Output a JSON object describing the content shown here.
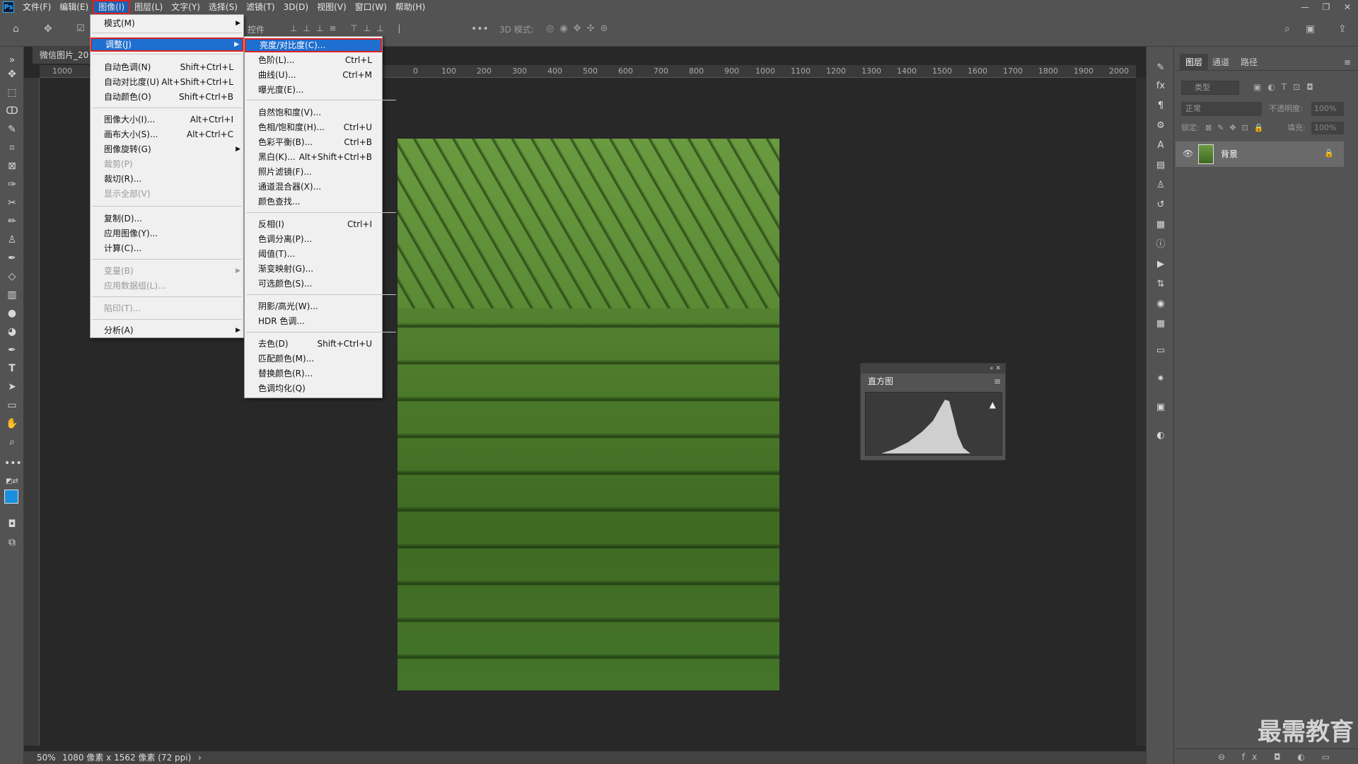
{
  "menubar": {
    "logo": "Ps",
    "items": [
      "文件(F)",
      "编辑(E)",
      "图像(I)",
      "图层(L)",
      "文字(Y)",
      "选择(S)",
      "滤镜(T)",
      "3D(D)",
      "视图(V)",
      "窗口(W)",
      "帮助(H)"
    ],
    "active_index": 2
  },
  "window_controls": [
    "—",
    "❐",
    "✕"
  ],
  "options_bar": {
    "partial_label": "控件",
    "mode_label": "3D 模式:",
    "more": "•••"
  },
  "document": {
    "tab_title": "微信图片_20",
    "ruler_ticks": [
      "1000",
      "90",
      "0",
      "100",
      "200",
      "300",
      "400",
      "500",
      "600",
      "700",
      "800",
      "900",
      "1000",
      "1100",
      "1200",
      "1300",
      "1400",
      "1500",
      "1600",
      "1700",
      "1800",
      "1900",
      "2000"
    ],
    "zoom": "50%",
    "doc_info": "1080 像素 x 1562 像素 (72 ppi)"
  },
  "image_menu": {
    "items": [
      {
        "label": "模式(M)",
        "shortcut": "",
        "submenu": true,
        "disabled": false
      },
      {
        "label": "调整(J)",
        "shortcut": "",
        "submenu": true,
        "disabled": false,
        "highlight": true
      },
      {
        "label": "自动色调(N)",
        "shortcut": "Shift+Ctrl+L",
        "disabled": false
      },
      {
        "label": "自动对比度(U)",
        "shortcut": "Alt+Shift+Ctrl+L",
        "disabled": false
      },
      {
        "label": "自动颜色(O)",
        "shortcut": "Shift+Ctrl+B",
        "disabled": false
      },
      {
        "label": "图像大小(I)...",
        "shortcut": "Alt+Ctrl+I",
        "disabled": false
      },
      {
        "label": "画布大小(S)...",
        "shortcut": "Alt+Ctrl+C",
        "disabled": false
      },
      {
        "label": "图像旋转(G)",
        "shortcut": "",
        "submenu": true,
        "disabled": false
      },
      {
        "label": "裁剪(P)",
        "shortcut": "",
        "disabled": true
      },
      {
        "label": "裁切(R)...",
        "shortcut": "",
        "disabled": false
      },
      {
        "label": "显示全部(V)",
        "shortcut": "",
        "disabled": true
      },
      {
        "label": "复制(D)...",
        "shortcut": "",
        "disabled": false
      },
      {
        "label": "应用图像(Y)...",
        "shortcut": "",
        "disabled": false
      },
      {
        "label": "计算(C)...",
        "shortcut": "",
        "disabled": false
      },
      {
        "label": "变量(B)",
        "shortcut": "",
        "submenu": true,
        "disabled": true
      },
      {
        "label": "应用数据组(L)...",
        "shortcut": "",
        "disabled": true
      },
      {
        "label": "陷印(T)...",
        "shortcut": "",
        "disabled": true
      },
      {
        "label": "分析(A)",
        "shortcut": "",
        "submenu": true,
        "disabled": false
      }
    ]
  },
  "adjust_menu": {
    "items": [
      {
        "label": "亮度/对比度(C)...",
        "shortcut": "",
        "highlight": true
      },
      {
        "label": "色阶(L)...",
        "shortcut": "Ctrl+L"
      },
      {
        "label": "曲线(U)...",
        "shortcut": "Ctrl+M"
      },
      {
        "label": "曝光度(E)...",
        "shortcut": ""
      },
      {
        "label": "自然饱和度(V)...",
        "shortcut": ""
      },
      {
        "label": "色相/饱和度(H)...",
        "shortcut": "Ctrl+U"
      },
      {
        "label": "色彩平衡(B)...",
        "shortcut": "Ctrl+B"
      },
      {
        "label": "黑白(K)...",
        "shortcut": "Alt+Shift+Ctrl+B"
      },
      {
        "label": "照片滤镜(F)...",
        "shortcut": ""
      },
      {
        "label": "通道混合器(X)...",
        "shortcut": ""
      },
      {
        "label": "颜色查找...",
        "shortcut": ""
      },
      {
        "label": "反相(I)",
        "shortcut": "Ctrl+I"
      },
      {
        "label": "色调分离(P)...",
        "shortcut": ""
      },
      {
        "label": "阈值(T)...",
        "shortcut": ""
      },
      {
        "label": "渐变映射(G)...",
        "shortcut": ""
      },
      {
        "label": "可选颜色(S)...",
        "shortcut": ""
      },
      {
        "label": "阴影/高光(W)...",
        "shortcut": ""
      },
      {
        "label": "HDR 色调...",
        "shortcut": ""
      },
      {
        "label": "去色(D)",
        "shortcut": "Shift+Ctrl+U"
      },
      {
        "label": "匹配颜色(M)...",
        "shortcut": ""
      },
      {
        "label": "替换颜色(R)...",
        "shortcut": ""
      },
      {
        "label": "色调均化(Q)",
        "shortcut": ""
      }
    ]
  },
  "histogram": {
    "tab": "直方图",
    "warning": "▲"
  },
  "layers_panel": {
    "tabs": [
      "图层",
      "通道",
      "路径"
    ],
    "active_tab": 0,
    "search_placeholder": "类型",
    "blend_mode": "正常",
    "opacity_label": "不透明度:",
    "opacity_value": "100%",
    "lock_label": "锁定:",
    "fill_label": "填充:",
    "fill_value": "100%",
    "layers": [
      {
        "name": "背景",
        "visible": true,
        "locked": true
      }
    ],
    "footer_icons": "⊖ fx ◘ ◐ ▭ ⊞ 🗑"
  },
  "watermark": "最需教育",
  "colors": {
    "ui_bg": "#535353",
    "canvas_bg": "#282828",
    "highlight": "#1f6fd0",
    "highlight_border": "#e02020"
  }
}
